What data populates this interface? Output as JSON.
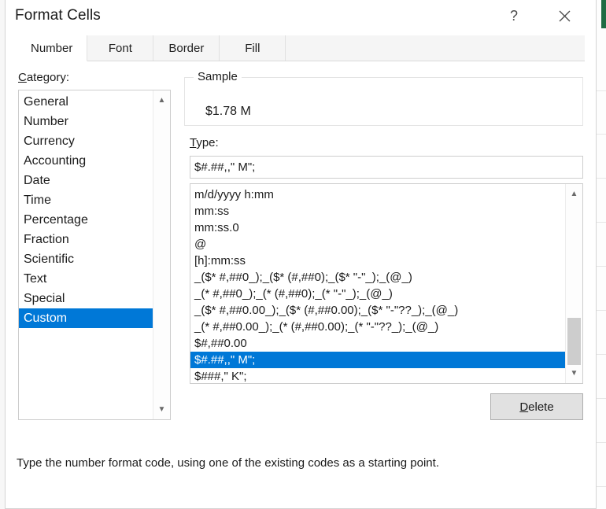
{
  "dialog": {
    "title": "Format Cells",
    "help_icon": "question-mark-icon",
    "close_icon": "close-icon"
  },
  "tabs": [
    {
      "label": "Number",
      "active": true
    },
    {
      "label": "Font",
      "active": false
    },
    {
      "label": "Border",
      "active": false
    },
    {
      "label": "Fill",
      "active": false
    }
  ],
  "category": {
    "label": "Category:",
    "label_prefix": "C",
    "label_rest": "ategory:",
    "items": [
      "General",
      "Number",
      "Currency",
      "Accounting",
      "Date",
      "Time",
      "Percentage",
      "Fraction",
      "Scientific",
      "Text",
      "Special",
      "Custom"
    ],
    "selected": "Custom"
  },
  "sample": {
    "legend": "Sample",
    "value": "$1.78 M"
  },
  "type": {
    "label_prefix": "T",
    "label_rest": "ype:",
    "value": "$#.##,,\" M\";"
  },
  "format_list": {
    "items": [
      "m/d/yyyy h:mm",
      "mm:ss",
      "mm:ss.0",
      "@",
      "[h]:mm:ss",
      "_($* #,##0_);_($* (#,##0);_($* \"-\"_);_(@_)",
      "_(* #,##0_);_(* (#,##0);_(* \"-\"_);_(@_)",
      "_($* #,##0.00_);_($* (#,##0.00);_($* \"-\"??_);_(@_)",
      "_(* #,##0.00_);_(* (#,##0.00);_(* \"-\"??_);_(@_)",
      "$#,##0.00",
      "$#.##,,\" M\";",
      "$###,\" K\";"
    ],
    "selected_index": 10
  },
  "buttons": {
    "delete_prefix": "D",
    "delete_rest": "elete"
  },
  "hint": {
    "text": "Type the number format code, using one of the existing codes as a starting point."
  },
  "colors": {
    "accent": "#0078d7",
    "dialog_bg": "#ffffff",
    "tab_inactive": "#f5f5f5",
    "excel_green": "#1e6b42",
    "button_face": "#e1e1e1"
  }
}
